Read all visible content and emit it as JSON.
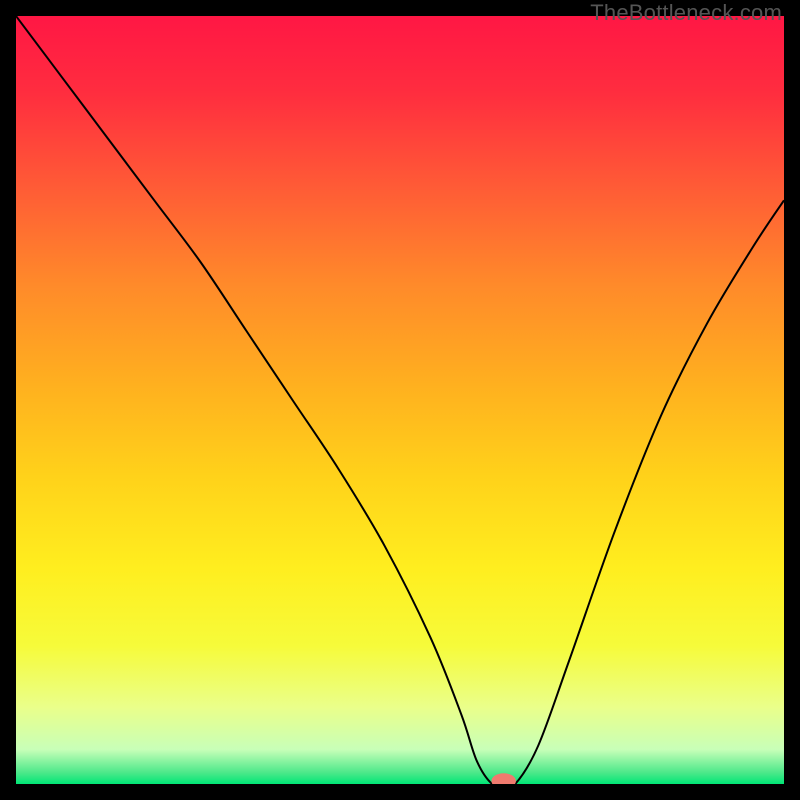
{
  "watermark": "TheBottleneck.com",
  "chart_data": {
    "type": "line",
    "title": "",
    "xlabel": "",
    "ylabel": "",
    "xlim": [
      0,
      100
    ],
    "ylim": [
      0,
      100
    ],
    "gradient_stops": [
      {
        "offset": 0.0,
        "color": "#ff1744"
      },
      {
        "offset": 0.1,
        "color": "#ff2d3f"
      },
      {
        "offset": 0.22,
        "color": "#ff5a36"
      },
      {
        "offset": 0.35,
        "color": "#ff8a2a"
      },
      {
        "offset": 0.48,
        "color": "#ffb01f"
      },
      {
        "offset": 0.6,
        "color": "#ffd21a"
      },
      {
        "offset": 0.72,
        "color": "#ffee1f"
      },
      {
        "offset": 0.82,
        "color": "#f6fb3a"
      },
      {
        "offset": 0.9,
        "color": "#eaff8a"
      },
      {
        "offset": 0.955,
        "color": "#c8ffb8"
      },
      {
        "offset": 0.985,
        "color": "#4de88a"
      },
      {
        "offset": 1.0,
        "color": "#00e676"
      }
    ],
    "series": [
      {
        "name": "bottleneck-curve",
        "x": [
          0,
          6,
          12,
          18,
          24,
          30,
          36,
          42,
          48,
          54,
          58,
          60,
          62,
          63.5,
          65,
          68,
          72,
          78,
          84,
          90,
          96,
          100
        ],
        "y": [
          100,
          92,
          84,
          76,
          68,
          59,
          50,
          41,
          31,
          19,
          9,
          3,
          0,
          0,
          0,
          5,
          16,
          33,
          48,
          60,
          70,
          76
        ]
      }
    ],
    "marker": {
      "name": "bottleneck-marker",
      "x": 63.5,
      "y": 0.4,
      "rx": 1.6,
      "ry": 1.0,
      "color": "#ef7a6e"
    }
  }
}
